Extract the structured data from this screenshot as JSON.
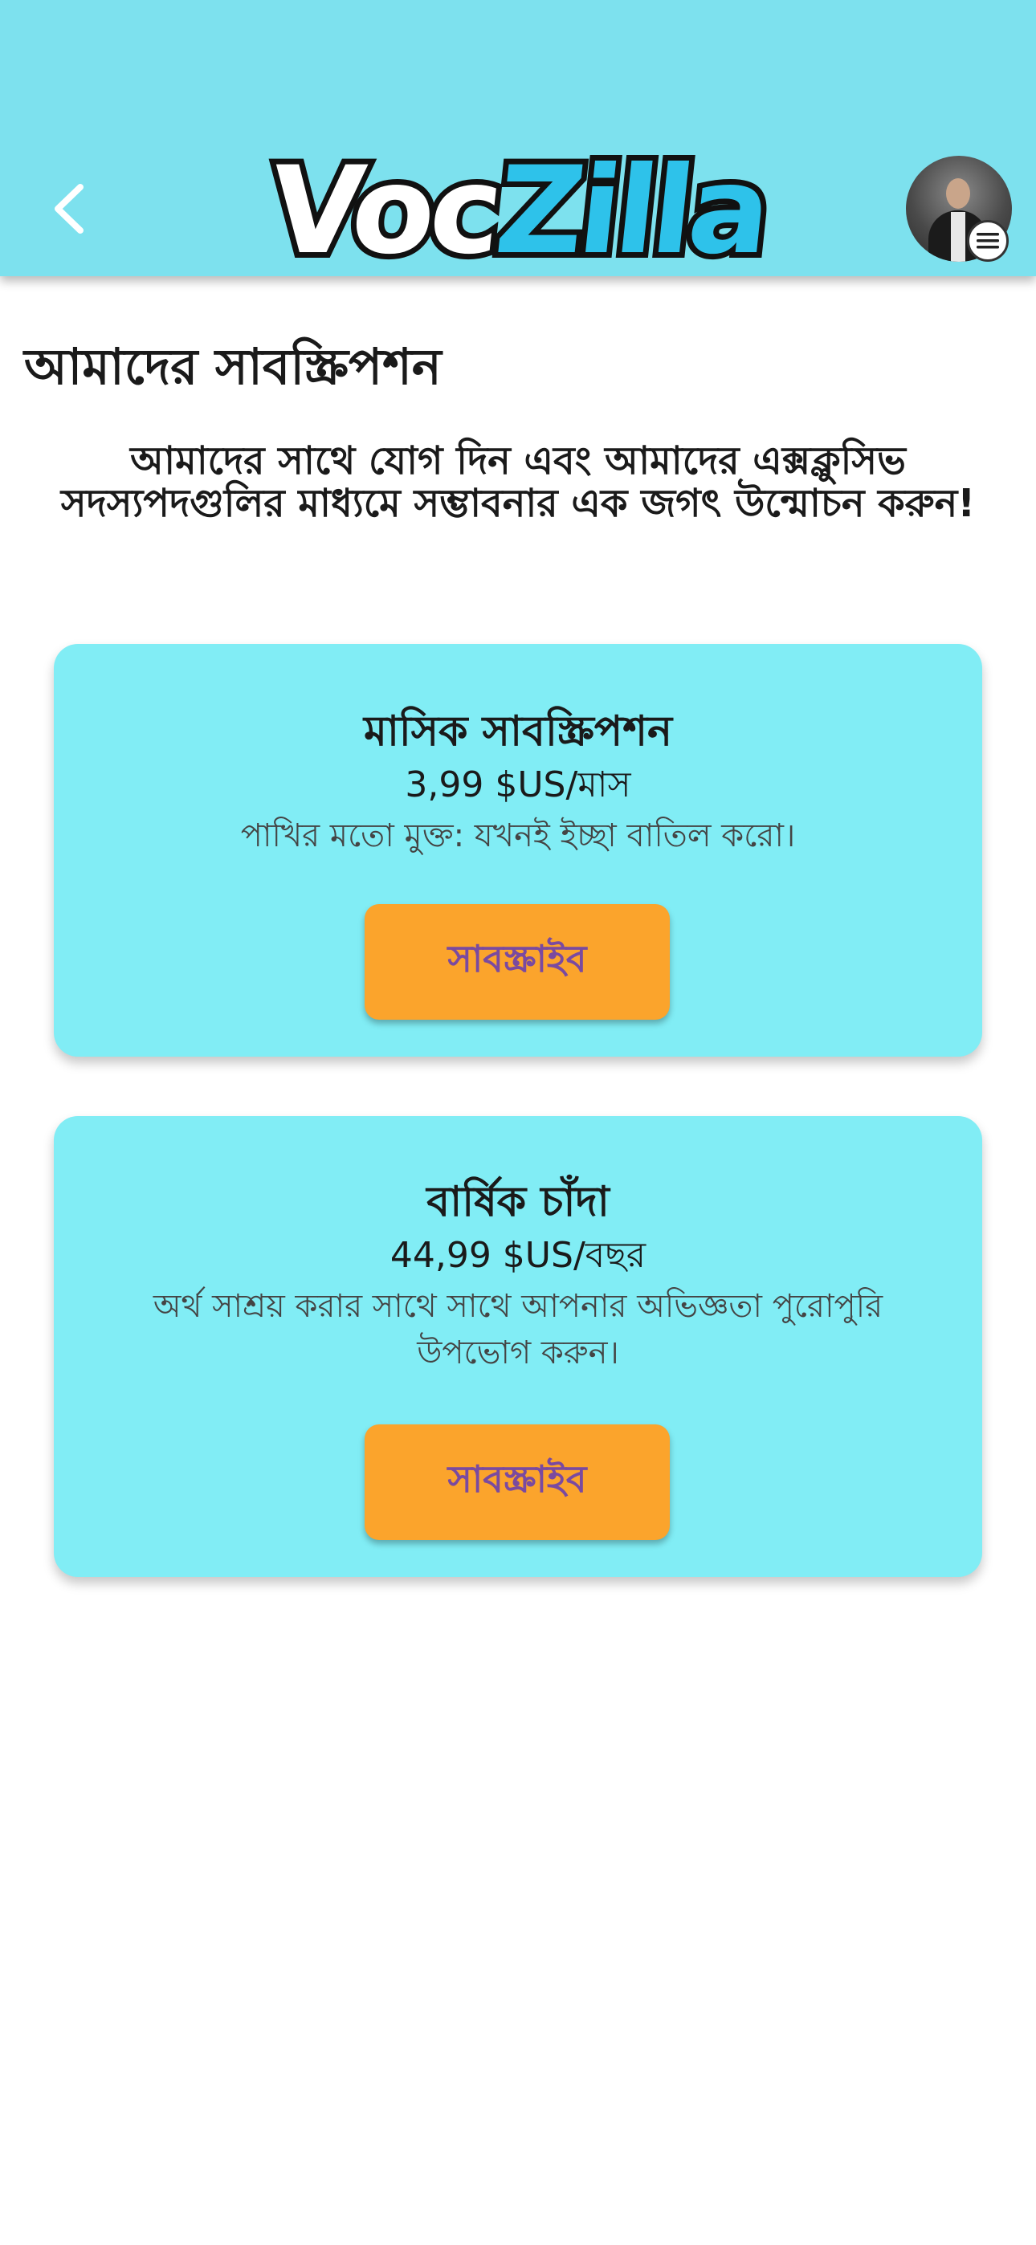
{
  "header": {
    "back_icon": "chevron-left-icon",
    "logo_part1": "Voc",
    "logo_part2": "Zilla",
    "menu_icon": "hamburger-menu-icon",
    "colors": {
      "background": "#7de1ee",
      "logo_accent": "#2ec2ea"
    }
  },
  "page": {
    "title": "আমাদের সাবস্ক্রিপশন",
    "intro": "আমাদের সাথে যোগ দিন এবং আমাদের এক্সক্লুসিভ সদস্যপদগুলির মাধ্যমে সম্ভাবনার এক জগৎ উন্মোচন করুন!"
  },
  "plans": [
    {
      "name": "মাসিক সাবস্ক্রিপশন",
      "price": "3,99 $US/মাস",
      "description": "পাখির মতো মুক্ত: যখনই ইচ্ছা বাতিল করো।",
      "button_label": "সাবস্ক্রাইব"
    },
    {
      "name": "বার্ষিক চাঁদা",
      "price": "44,99 $US/বছর",
      "description": "অর্থ সাশ্রয় করার সাথে সাথে আপনার অভিজ্ঞতা পুরোপুরি উপভোগ করুন।",
      "button_label": "সাবস্ক্রাইব"
    }
  ],
  "colors": {
    "card_background": "#81edf5",
    "button_background": "#fba42c",
    "button_text": "#7a4aa0"
  }
}
